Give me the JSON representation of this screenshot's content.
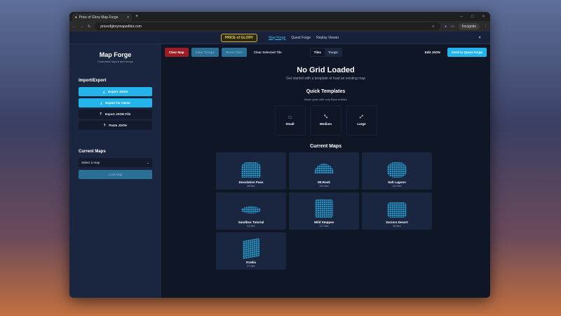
{
  "browser": {
    "tab_title": "Price of Glory Map Forge",
    "url": "priceofglorymapeditor.com",
    "incognito": "Incognito"
  },
  "header": {
    "logo": "PRICE of GLORY",
    "nav": [
      "Map Forge",
      "Quest Forge",
      "Replay Viewer"
    ]
  },
  "sidebar": {
    "title": "Map Forge",
    "subtitle": "Customize layout and troops",
    "import_export": "Import/Export",
    "buttons": [
      "Export JSON",
      "Export for Game",
      "Import JSON File",
      "Paste JSON"
    ],
    "current_maps": "Current Maps",
    "select_placeholder": "Select a map",
    "load": "Load Map"
  },
  "toolbar": {
    "clear_map": "Clear Map",
    "clear_troops": "Clear Troops",
    "reset_tiles": "Reset Tiles",
    "clear_selected": "Clear Selected Tile",
    "tiles": "Tiles",
    "troops": "Troops",
    "edit_json": "Edit JSON",
    "send": "Send to Quest Forge"
  },
  "main": {
    "title": "No Grid Loaded",
    "subtitle": "Get started with a template or load an existing map",
    "quick": "Quick Templates",
    "quick_sub": "Blank grids with only Base entities",
    "templates": [
      "Small",
      "Medium",
      "Large"
    ],
    "current_maps": "Current Maps",
    "maps": [
      {
        "name": "Desolation Pass",
        "tiles": "88 tiles"
      },
      {
        "name": "Mt.Rook",
        "tiles": "191 tiles"
      },
      {
        "name": "Salt Lagoon",
        "tiles": "142 tiles"
      },
      {
        "name": "Sandbox Tutorial",
        "tiles": "81 tiles"
      },
      {
        "name": "Wild Steppes",
        "tiles": "137 tiles"
      },
      {
        "name": "Zarzora Desert",
        "tiles": "80 tiles"
      },
      {
        "name": "Krakia",
        "tiles": "87 tiles"
      }
    ]
  }
}
